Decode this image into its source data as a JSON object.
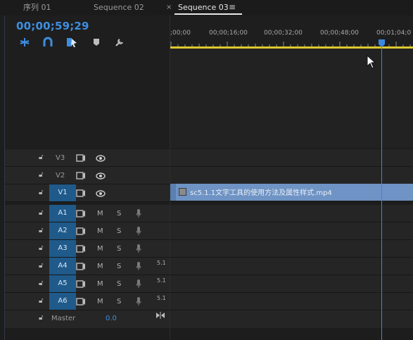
{
  "tabs": [
    {
      "label": "序列 01",
      "active": false
    },
    {
      "label": "Sequence 02",
      "active": false
    },
    {
      "label": "Sequence 03",
      "active": true
    }
  ],
  "tab_close_glyph": "×",
  "tab_menu_glyph": "≡",
  "timecode": "00;00;59;29",
  "toolbar_icons": [
    "snap-icon",
    "magnet-icon",
    "linked-selection-icon",
    "add-marker-icon",
    "wrench-icon"
  ],
  "ruler": {
    "labels": [
      ";00;00",
      "00;00;16;00",
      "00;00;32;00",
      "00;00;48;00",
      "00;01;04;0"
    ]
  },
  "tracks": {
    "video": [
      {
        "name": "V3",
        "targeted": false
      },
      {
        "name": "V2",
        "targeted": false
      },
      {
        "name": "V1",
        "targeted": true
      }
    ],
    "audio": [
      {
        "name": "A1",
        "targeted": true,
        "mute": "M",
        "solo": "S",
        "channels": ""
      },
      {
        "name": "A2",
        "targeted": true,
        "mute": "M",
        "solo": "S",
        "channels": ""
      },
      {
        "name": "A3",
        "targeted": true,
        "mute": "M",
        "solo": "S",
        "channels": ""
      },
      {
        "name": "A4",
        "targeted": true,
        "mute": "M",
        "solo": "S",
        "channels": "5.1"
      },
      {
        "name": "A5",
        "targeted": true,
        "mute": "M",
        "solo": "S",
        "channels": "5.1"
      },
      {
        "name": "A6",
        "targeted": true,
        "mute": "M",
        "solo": "S",
        "channels": "5.1"
      }
    ],
    "master": {
      "name": "Master",
      "value": "0.0"
    }
  },
  "clip": {
    "label": "sc5.1.1文字工具的使用方法及属性样式.mp4",
    "color": "#6e93c4"
  },
  "colors": {
    "accent": "#3d8ee0",
    "target_track": "#1f5a8a",
    "work_area_bar": "#dcc92e",
    "playhead": "#3b88e0"
  }
}
